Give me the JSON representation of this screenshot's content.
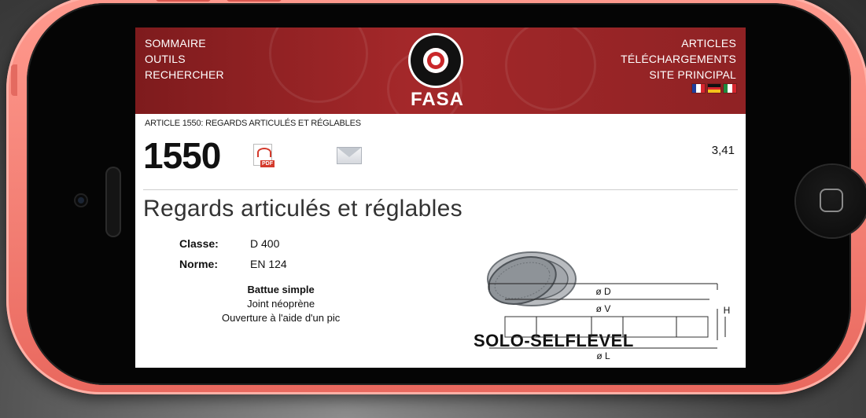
{
  "header": {
    "nav_left": [
      "SOMMAIRE",
      "OUTILS",
      "RECHERCHER"
    ],
    "nav_right": [
      "ARTICLES",
      "TÉLÉCHARGEMENTS",
      "SITE PRINCIPAL"
    ],
    "logo_text": "FASA",
    "flags": [
      "flag-fr",
      "flag-de",
      "flag-it"
    ]
  },
  "breadcrumb": "ARTICLE 1550: REGARDS ARTICULÉS ET RÉGLABLES",
  "article": {
    "number": "1550",
    "price": "3,41",
    "pdf_tag": "PDF"
  },
  "product": {
    "title": "Regards articulés et réglables",
    "specs": [
      {
        "label": "Classe:",
        "value": "D 400"
      },
      {
        "label": "Norme:",
        "value": "EN 124"
      }
    ],
    "feature_title": "Battue simple",
    "features": [
      "Joint néoprène",
      "Ouverture à l'aide d'un pic"
    ],
    "name": "SOLO-SELFLEVEL"
  },
  "diagram": {
    "labels": {
      "h": "H",
      "d": "ø D",
      "v": "ø V",
      "l": "ø L"
    }
  },
  "colors": {
    "header_red": "#a4282a",
    "phone_pink": "#f27d72"
  }
}
